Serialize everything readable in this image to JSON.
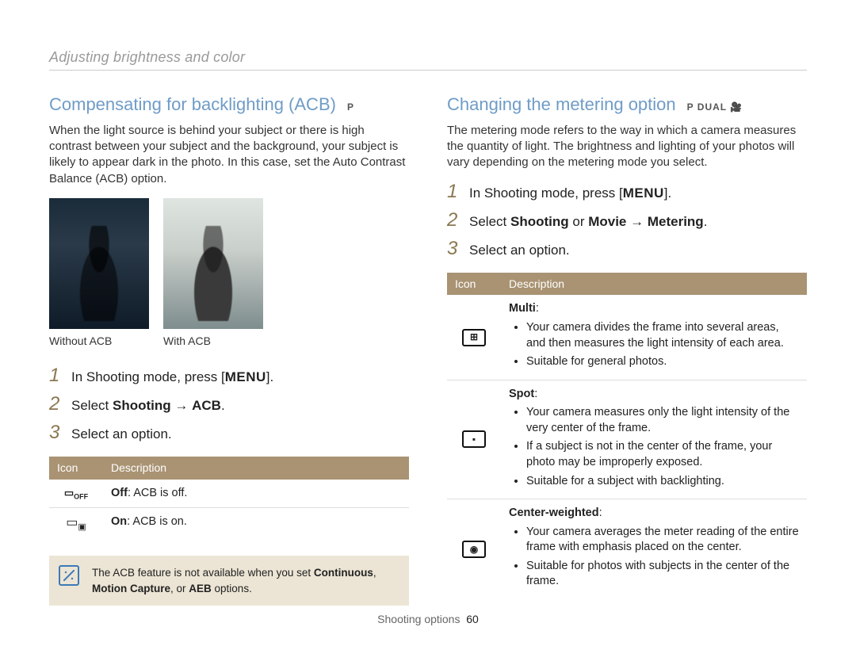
{
  "header": "Adjusting brightness and color",
  "left": {
    "title": "Compensating for backlighting (ACB)",
    "modes": "P",
    "intro": "When the light source is behind your subject or there is high contrast between your subject and the background, your subject is likely to appear dark in the photo. In this case, set the Auto Contrast Balance (ACB) option.",
    "caption1": "Without ACB",
    "caption2": "With ACB",
    "steps": {
      "s1_a": "In Shooting mode, press [",
      "s1_menu": "MENU",
      "s1_b": "].",
      "s2_a": "Select ",
      "s2_b": "Shooting",
      "s2_c": " → ",
      "s2_d": "ACB",
      "s2_e": ".",
      "s3": "Select an option."
    },
    "table": {
      "h1": "Icon",
      "h2": "Description",
      "rows": [
        {
          "iconText": "OFF",
          "label": "Off",
          "desc": ": ACB is off."
        },
        {
          "iconText": "",
          "label": "On",
          "desc": ": ACB is on."
        }
      ]
    },
    "note_a": "The ACB feature is not available when you set ",
    "note_b": "Continuous",
    "note_c": ", ",
    "note_d": "Motion Capture",
    "note_e": ", or ",
    "note_f": "AEB",
    "note_g": " options."
  },
  "right": {
    "title": "Changing the metering option",
    "modes": "P  DUAL  🎥",
    "intro": "The metering mode refers to the way in which a camera measures the quantity of light. The brightness and lighting of your photos will vary depending on the metering mode you select.",
    "steps": {
      "s1_a": "In Shooting mode, press [",
      "s1_menu": "MENU",
      "s1_b": "].",
      "s2_a": "Select ",
      "s2_b": "Shooting",
      "s2_c": " or ",
      "s2_d": "Movie",
      "s2_e": " → ",
      "s2_f": "Metering",
      "s2_g": ".",
      "s3": "Select an option."
    },
    "table": {
      "h1": "Icon",
      "h2": "Description",
      "rows": [
        {
          "iconGlyph": "⊞",
          "label": "Multi",
          "bullets": [
            "Your camera divides the frame into several areas, and then measures the light intensity of each area.",
            "Suitable for general photos."
          ]
        },
        {
          "iconGlyph": "▪",
          "label": "Spot",
          "bullets": [
            "Your camera measures only the light intensity of the very center of the frame.",
            "If a subject is not in the center of the frame, your photo may be improperly exposed.",
            "Suitable for a subject with backlighting."
          ]
        },
        {
          "iconGlyph": "◉",
          "label": "Center-weighted",
          "bullets": [
            "Your camera averages the meter reading of the entire frame with emphasis placed on the center.",
            "Suitable for photos with subjects in the center of the frame."
          ]
        }
      ]
    }
  },
  "footer": {
    "section": "Shooting options",
    "page": "60"
  }
}
